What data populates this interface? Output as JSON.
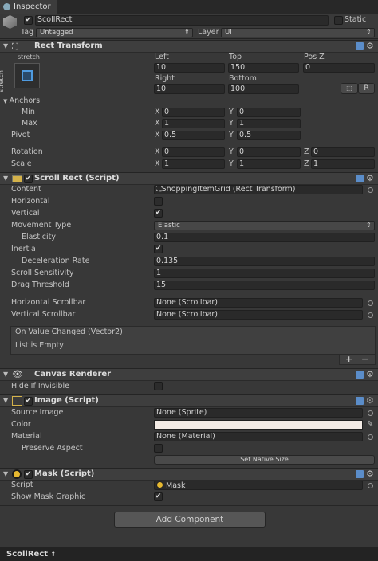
{
  "tab": {
    "title": "Inspector"
  },
  "header": {
    "object_name": "ScollRect",
    "static_label": "Static",
    "tag_label": "Tag",
    "tag_value": "Untagged",
    "layer_label": "Layer",
    "layer_value": "UI"
  },
  "rect_transform": {
    "title": "Rect Transform",
    "anchor_preset": "stretch",
    "anchor_side": "stretch",
    "col1": "Left",
    "col2": "Top",
    "col3": "Pos Z",
    "left": "10",
    "top": "150",
    "pos_z": "0",
    "col4": "Right",
    "col5": "Bottom",
    "right": "10",
    "bottom": "100",
    "raw_button": "R",
    "anchors_label": "Anchors",
    "min_label": "Min",
    "max_label": "Max",
    "pivot_label": "Pivot",
    "min_x": "0",
    "min_y": "0",
    "max_x": "1",
    "max_y": "1",
    "pivot_x": "0.5",
    "pivot_y": "0.5",
    "rotation_label": "Rotation",
    "scale_label": "Scale",
    "rot_x": "0",
    "rot_y": "0",
    "rot_z": "0",
    "scale_x": "1",
    "scale_y": "1",
    "scale_z": "1",
    "x": "X",
    "y": "Y",
    "z": "Z"
  },
  "scroll_rect": {
    "title": "Scroll Rect (Script)",
    "content_label": "Content",
    "content_value": "ShoppingItemGrid (Rect Transform)",
    "horizontal_label": "Horizontal",
    "vertical_label": "Vertical",
    "movement_label": "Movement Type",
    "movement_value": "Elastic",
    "elasticity_label": "Elasticity",
    "elasticity_value": "0.1",
    "inertia_label": "Inertia",
    "decel_label": "Deceleration Rate",
    "decel_value": "0.135",
    "sensitivity_label": "Scroll Sensitivity",
    "sensitivity_value": "1",
    "drag_label": "Drag Threshold",
    "drag_value": "15",
    "hscroll_label": "Horizontal Scrollbar",
    "hscroll_value": "None (Scrollbar)",
    "vscroll_label": "Vertical Scrollbar",
    "vscroll_value": "None (Scrollbar)",
    "event_title": "On Value Changed (Vector2)",
    "event_body": "List is Empty",
    "add": "+",
    "remove": "−"
  },
  "canvas_renderer": {
    "title": "Canvas Renderer",
    "hide_label": "Hide If Invisible"
  },
  "image": {
    "title": "Image (Script)",
    "source_label": "Source Image",
    "source_value": "None (Sprite)",
    "color_label": "Color",
    "color_value": "#f3ebe5",
    "material_label": "Material",
    "material_value": "None (Material)",
    "preserve_label": "Preserve Aspect",
    "native_button": "Set Native Size"
  },
  "mask": {
    "title": "Mask (Script)",
    "script_label": "Script",
    "script_value": "Mask",
    "show_label": "Show Mask Graphic"
  },
  "add_component": "Add Component",
  "footer": {
    "label": "ScollRect",
    "icon": "updown-icon"
  }
}
